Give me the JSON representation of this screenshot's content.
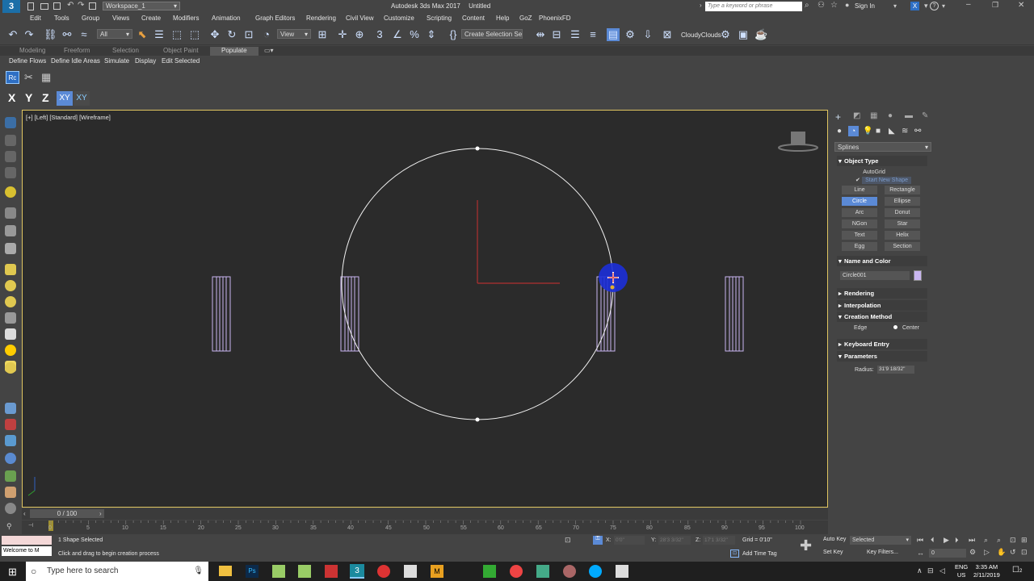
{
  "window": {
    "workspace": "Workspace_1",
    "title": "Autodesk 3ds Max 2017",
    "doc": "Untitled",
    "search_placeholder": "Type a keyword or phrase",
    "signin": "Sign In"
  },
  "menu": [
    "Edit",
    "Tools",
    "Group",
    "Views",
    "Create",
    "Modifiers",
    "Animation",
    "Graph Editors",
    "Rendering",
    "Civil View",
    "Customize",
    "Scripting",
    "Content",
    "Help",
    "GoZ",
    "PhoenixFD"
  ],
  "toolbar": {
    "filter": "All",
    "refcoord": "View",
    "selset": "Create Selection Se",
    "cloud": "CloudyClouds"
  },
  "ribbon": {
    "tabs": [
      "Modeling",
      "Freeform",
      "Selection",
      "Object Paint",
      "Populate"
    ],
    "subitems": [
      "Define Flows",
      "Define Idle Areas",
      "Simulate",
      "Display",
      "Edit Selected"
    ]
  },
  "axis": [
    "X",
    "Y",
    "Z",
    "XY",
    "XY"
  ],
  "viewport": {
    "label": "[+] [Left] [Standard] [Wireframe]"
  },
  "cmdpanel": {
    "category": "Splines",
    "object_type": "Object Type",
    "autogrid": "AutoGrid",
    "start_new_shape": "Start New Shape",
    "buttons": [
      "Line",
      "Rectangle",
      "Circle",
      "Ellipse",
      "Arc",
      "Donut",
      "NGon",
      "Star",
      "Text",
      "Helix",
      "Egg",
      "Section"
    ],
    "name_color": "Name and Color",
    "object_name": "Circle001",
    "rendering": "Rendering",
    "interpolation": "Interpolation",
    "creation_method": "Creation Method",
    "edge": "Edge",
    "center": "Center",
    "keyboard_entry": "Keyboard Entry",
    "parameters": "Parameters",
    "radius_label": "Radius:",
    "radius_value": "31'9 18/32\"",
    "swatch_color": "#c9b6f0"
  },
  "timeline": {
    "frame": "0 / 100",
    "ticks": [
      "0",
      "5",
      "10",
      "15",
      "20",
      "25",
      "30",
      "35",
      "40",
      "45",
      "50",
      "55",
      "60",
      "65",
      "70",
      "75",
      "80",
      "85",
      "90",
      "95",
      "100"
    ]
  },
  "status": {
    "listener": "Welcome to M",
    "selected": "1 Shape Selected",
    "prompt": "Click and drag to begin creation process",
    "x_label": "X:",
    "x_value": "0'0\"",
    "y_label": "Y:",
    "y_value": "28'3 3/32\"",
    "z_label": "Z:",
    "z_value": "17'1 3/32\"",
    "grid": "Grid = 0'10\"",
    "add_time_tag": "Add Time Tag",
    "auto_key": "Auto Key",
    "set_key": "Set Key",
    "key_mode": "Selected",
    "key_filters": "Key Filters...",
    "current_frame": "0"
  },
  "taskbar": {
    "search": "Type here to search",
    "lang1": "ENG",
    "lang2": "US",
    "time": "3:35 AM",
    "date": "2/11/2019",
    "notif": "2"
  }
}
